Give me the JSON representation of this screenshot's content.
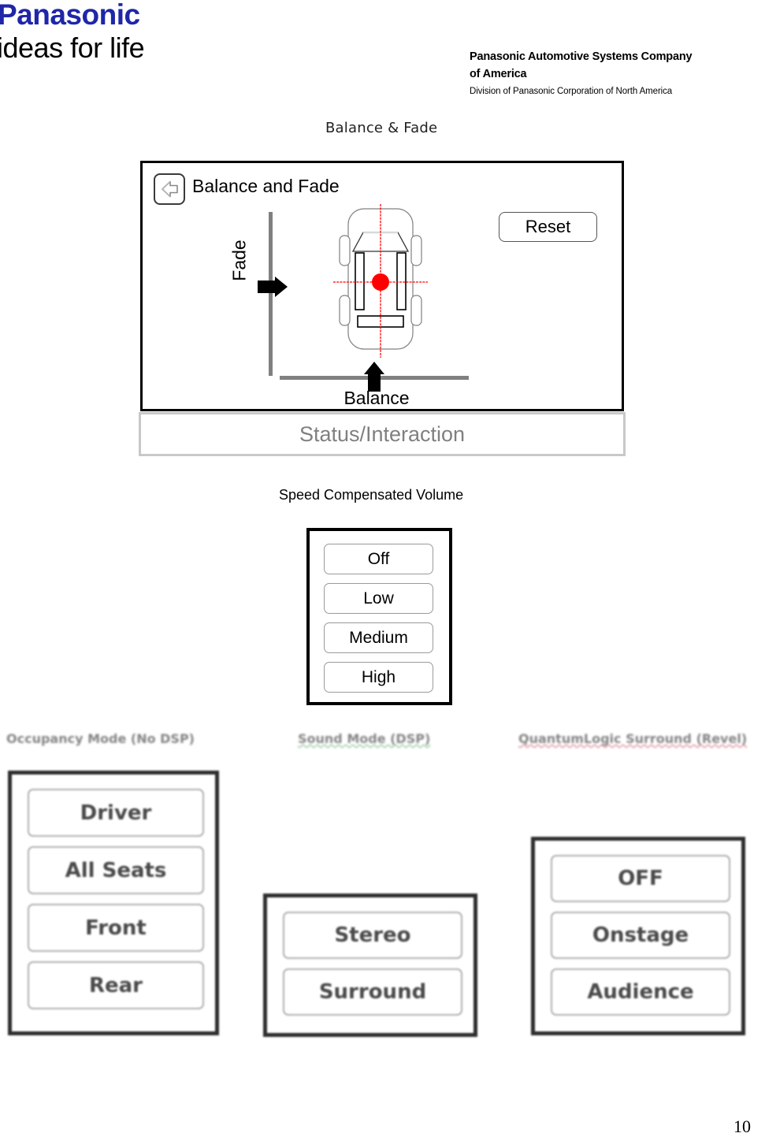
{
  "header": {
    "brand": "Panasonic",
    "tagline": "ideas for life",
    "company_line1": "Panasonic Automotive Systems Company",
    "company_line2": "of America",
    "division": "Division of Panasonic Corporation of North America",
    "brand_color": "#1f26a8"
  },
  "captions": {
    "balance_fade": "Balance & Fade",
    "speed_compensated_volume": "Speed Compensated Volume"
  },
  "balance_fade_panel": {
    "back_icon": "back-arrow-icon",
    "title": "Balance and Fade",
    "reset_label": "Reset",
    "fade_label": "Fade",
    "balance_label": "Balance",
    "car_icon": "car-top-view-icon",
    "crosshair_color": "#ff0000",
    "position_dot_color": "#ff0000",
    "slider_track_color": "#808080",
    "handle_color": "#000000"
  },
  "status_bar": {
    "label": "Status/Interaction",
    "text_color": "#808080",
    "border_color": "#c8c8c8"
  },
  "speed_compensated_volume": {
    "options": [
      {
        "label": "Off"
      },
      {
        "label": "Low"
      },
      {
        "label": "Medium"
      },
      {
        "label": "High"
      }
    ]
  },
  "bottom_groups": [
    {
      "caption": "Occupancy Mode (No DSP)",
      "spell_underline": "none",
      "options": [
        {
          "label": "Driver"
        },
        {
          "label": "All Seats"
        },
        {
          "label": "Front"
        },
        {
          "label": "Rear"
        }
      ]
    },
    {
      "caption": "Sound Mode (DSP)",
      "spell_underline": "green",
      "options": [
        {
          "label": "Stereo"
        },
        {
          "label": "Surround"
        }
      ]
    },
    {
      "caption": "QuantumLogic Surround (Revel)",
      "spell_underline": "red",
      "options": [
        {
          "label": "OFF"
        },
        {
          "label": "Onstage"
        },
        {
          "label": "Audience"
        }
      ]
    }
  ],
  "footer": {
    "page_number": "10"
  }
}
